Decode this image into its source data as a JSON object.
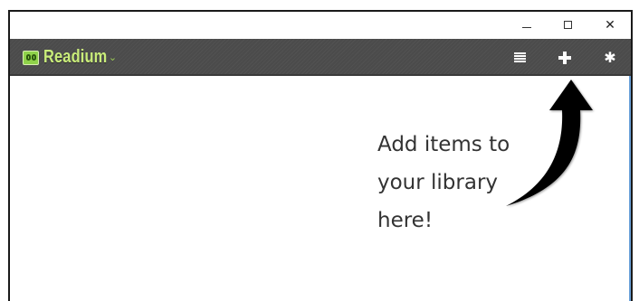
{
  "window": {
    "controls": {
      "minimize_icon": "minimize-icon",
      "maximize_icon": "maximize-icon",
      "close_icon": "close-icon",
      "close_glyph": "✕"
    }
  },
  "toolbar": {
    "app_name": "Readium",
    "brand_caret": "⌄",
    "logo_icon": "readium-logo-icon",
    "buttons": [
      {
        "name": "library-list",
        "icon": "list-view-icon"
      },
      {
        "name": "add-to-library",
        "icon": "plus-icon"
      },
      {
        "name": "settings",
        "icon": "gear-icon"
      }
    ],
    "gear_glyph": "✱",
    "colors": {
      "background": "#4b4b4b",
      "brand": "#c9ec7a",
      "icons": "#ffffff"
    }
  },
  "empty_state": {
    "hint": "Add items to\nyour library\nhere!",
    "arrow_icon": "curved-arrow-icon"
  }
}
